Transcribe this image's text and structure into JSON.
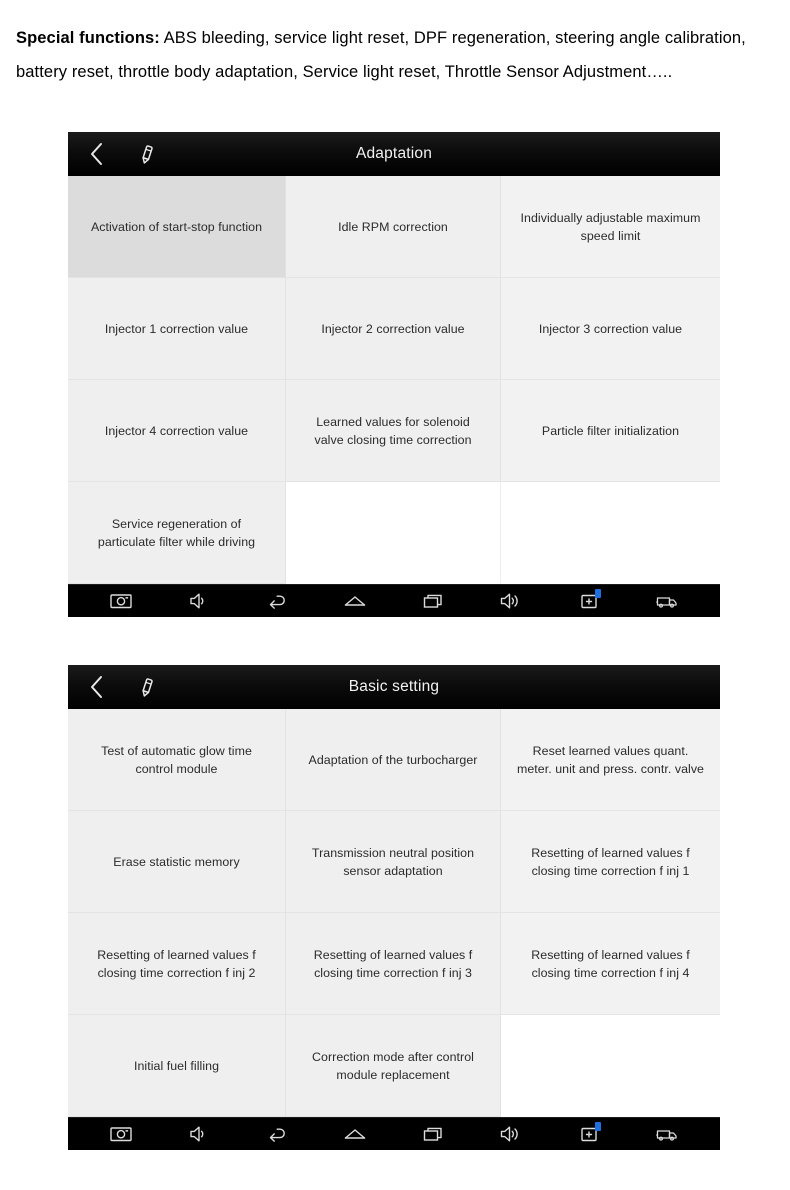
{
  "intro": {
    "lead": "Special functions:",
    "body": " ABS bleeding, service light reset, DPF regeneration, steering angle calibration, battery reset, throttle body adaptation, Service light reset, Throttle Sensor Adjustment….."
  },
  "colors": {
    "titlebar_bg": "#000000",
    "cell_bg": "#efefef",
    "cell_selected_bg": "#dcdcdc",
    "navbar_bg": "#000000",
    "badge_accent": "#1f6fe0",
    "text": "#2b2b2b"
  },
  "devices": [
    {
      "id": "adaptation",
      "titlebar": {
        "back_icon": "chevron-left-icon",
        "edit_icon": "pencil-icon",
        "title": "Adaptation"
      },
      "grid": {
        "columns": 3,
        "rows": 4,
        "cells": [
          {
            "label": "Activation of start-stop function",
            "selected": true
          },
          {
            "label": "Idle RPM correction",
            "selected": false
          },
          {
            "label": "Individually adjustable maximum speed limit",
            "selected": false
          },
          {
            "label": "Injector 1 correction value",
            "selected": false
          },
          {
            "label": "Injector 2 correction value",
            "selected": false
          },
          {
            "label": "Injector 3 correction value",
            "selected": false
          },
          {
            "label": "Injector 4 correction value",
            "selected": false
          },
          {
            "label": "Learned values for solenoid valve closing time correction",
            "selected": false
          },
          {
            "label": "Particle filter initialization",
            "selected": false
          },
          {
            "label": "Service regeneration of particulate filter while driving",
            "selected": false
          },
          {
            "label": "",
            "selected": false,
            "empty": true
          },
          {
            "label": "",
            "selected": false,
            "empty": true
          }
        ]
      },
      "navbar": {
        "buttons": [
          {
            "icon": "screenshot-camera-icon",
            "badge": false
          },
          {
            "icon": "volume-down-icon",
            "badge": false
          },
          {
            "icon": "back-icon",
            "badge": false
          },
          {
            "icon": "home-icon",
            "badge": false
          },
          {
            "icon": "recent-apps-icon",
            "badge": false
          },
          {
            "icon": "volume-up-icon",
            "badge": false
          },
          {
            "icon": "add-screenshot-icon",
            "badge": true
          },
          {
            "icon": "vehicle-truck-icon",
            "badge": false
          }
        ]
      }
    },
    {
      "id": "basic-setting",
      "titlebar": {
        "back_icon": "chevron-left-icon",
        "edit_icon": "pencil-icon",
        "title": "Basic setting"
      },
      "grid": {
        "columns": 3,
        "rows": 4,
        "cells": [
          {
            "label": "Test of automatic glow time control module",
            "selected": false
          },
          {
            "label": "Adaptation of the turbocharger",
            "selected": false
          },
          {
            "label": "Reset learned values quant. meter. unit and press. contr. valve",
            "selected": false
          },
          {
            "label": "Erase statistic memory",
            "selected": false
          },
          {
            "label": "Transmission neutral position sensor adaptation",
            "selected": false
          },
          {
            "label": "Resetting of learned values f closing time correction f inj 1",
            "selected": false
          },
          {
            "label": "Resetting of learned values f closing time correction f inj 2",
            "selected": false
          },
          {
            "label": "Resetting of learned values f closing time correction f inj 3",
            "selected": false
          },
          {
            "label": "Resetting of learned values f closing time correction f inj 4",
            "selected": false
          },
          {
            "label": "Initial fuel filling",
            "selected": false
          },
          {
            "label": "Correction mode after control module replacement",
            "selected": false
          },
          {
            "label": "",
            "selected": false,
            "empty": true
          }
        ]
      },
      "navbar": {
        "buttons": [
          {
            "icon": "screenshot-camera-icon",
            "badge": false
          },
          {
            "icon": "volume-down-icon",
            "badge": false
          },
          {
            "icon": "back-icon",
            "badge": false
          },
          {
            "icon": "home-icon",
            "badge": false
          },
          {
            "icon": "recent-apps-icon",
            "badge": false
          },
          {
            "icon": "volume-up-icon",
            "badge": false
          },
          {
            "icon": "add-screenshot-icon",
            "badge": true
          },
          {
            "icon": "vehicle-truck-icon",
            "badge": false
          }
        ]
      }
    }
  ]
}
